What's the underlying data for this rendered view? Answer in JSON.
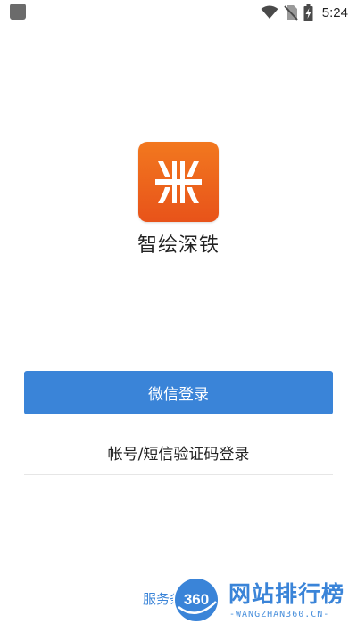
{
  "status_bar": {
    "time": "5:24",
    "icons": [
      "app-notification-icon",
      "wifi-icon",
      "no-sim-icon",
      "battery-charging-icon"
    ]
  },
  "app": {
    "name": "智绘深铁",
    "logo": "shenzhen-metro-logo"
  },
  "login": {
    "wechat_label": "微信登录",
    "alt_label": "帐号/短信验证码登录"
  },
  "footer": {
    "terms_text": "服务条"
  },
  "watermark": {
    "badge_text": "360",
    "title": "网站排行榜",
    "subtitle": "-WANGZHAN360.CN-"
  },
  "colors": {
    "accent": "#3a84d8",
    "logo_top": "#f2781f",
    "logo_bottom": "#e8531a"
  }
}
